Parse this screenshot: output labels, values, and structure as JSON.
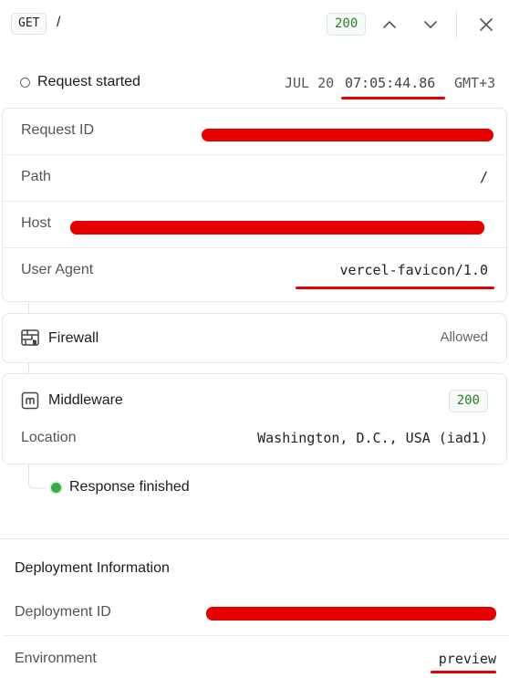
{
  "topbar": {
    "method": "GET",
    "path": "/",
    "status": "200",
    "up_icon": "chevron-up-icon",
    "down_icon": "chevron-down-icon",
    "close_icon": "close-icon"
  },
  "request_started": {
    "label": "Request started",
    "date": "JUL 20",
    "time": "07:05:44.86",
    "timezone": "GMT+3"
  },
  "request_details": {
    "rows": [
      {
        "label": "Request ID",
        "value": ""
      },
      {
        "label": "Path",
        "value": "/"
      },
      {
        "label": "Host",
        "value": ""
      },
      {
        "label": "User Agent",
        "value": "vercel-favicon/1.0"
      }
    ]
  },
  "firewall": {
    "icon": "firewall-grid-icon",
    "title": "Firewall",
    "status": "Allowed"
  },
  "middleware": {
    "icon": "middleware-m-icon",
    "title": "Middleware",
    "status": "200",
    "location_label": "Location",
    "location_value": "Washington, D.C., USA (iad1)"
  },
  "response": {
    "label": "Response finished",
    "status_color": "#3da74b"
  },
  "deployment": {
    "title": "Deployment Information",
    "rows": [
      {
        "label": "Deployment ID",
        "value": ""
      },
      {
        "label": "Environment",
        "value": "preview"
      }
    ]
  },
  "colors": {
    "annotation_red": "#e60000",
    "success_green": "#2f7d34"
  }
}
